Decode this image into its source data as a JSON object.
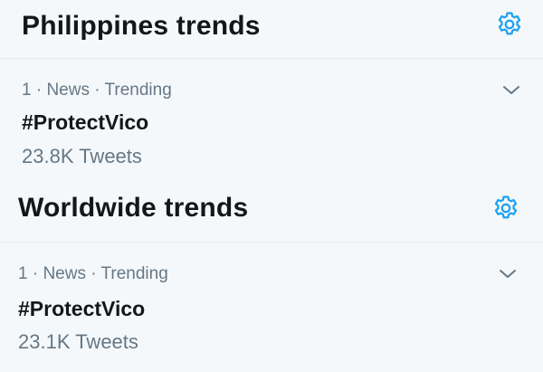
{
  "accent_color": "#1da1f2",
  "sections": [
    {
      "title": "Philippines trends",
      "settings_icon": "gear-icon",
      "trends": [
        {
          "rank": "1",
          "category": "News",
          "status": "Trending",
          "meta": "1 · News · Trending",
          "name": "#ProtectVico",
          "tweet_count": "23.8K Tweets",
          "menu_icon": "chevron-down-icon"
        }
      ]
    },
    {
      "title": "Worldwide trends",
      "settings_icon": "gear-icon",
      "trends": [
        {
          "rank": "1",
          "category": "News",
          "status": "Trending",
          "meta": "1 · News · Trending",
          "name": "#ProtectVico",
          "tweet_count": "23.1K Tweets",
          "menu_icon": "chevron-down-icon"
        }
      ]
    }
  ]
}
